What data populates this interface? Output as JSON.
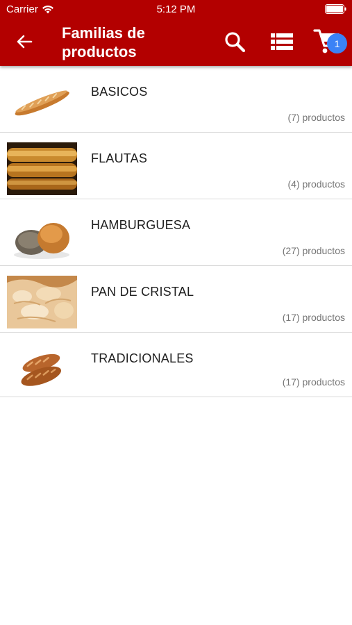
{
  "status_bar": {
    "carrier": "Carrier",
    "time": "5:12 PM"
  },
  "header": {
    "title": "Familias de productos",
    "cart_count": "1",
    "accent_color": "#b30000",
    "badge_color": "#3b82f6",
    "icons": [
      "arrow-left-icon",
      "search-icon",
      "list-icon",
      "cart-icon"
    ]
  },
  "families": [
    {
      "name": "BASICOS",
      "count": "(7) productos",
      "image": "baguette"
    },
    {
      "name": "FLAUTAS",
      "count": "(4) productos",
      "image": "flutes"
    },
    {
      "name": "HAMBURGUESA",
      "count": "(27) productos",
      "image": "buns"
    },
    {
      "name": "PAN DE CRISTAL",
      "count": "(17) productos",
      "image": "crystal-bread"
    },
    {
      "name": "TRADICIONALES",
      "count": "(17) productos",
      "image": "rustic-loaves"
    }
  ]
}
